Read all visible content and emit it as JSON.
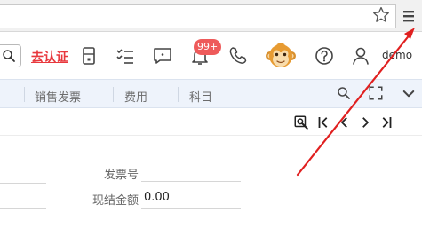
{
  "browser": {
    "bookmark_icon": "star-icon",
    "menu_icon": "hamburger-menu-icon"
  },
  "header": {
    "search_icon": "search-icon",
    "verify_link": "去认证",
    "icons": [
      "calculator-icon",
      "task-checklist-icon",
      "message-icon",
      "notification-bell-icon",
      "phone-icon",
      "help-circle-icon",
      "user-icon"
    ],
    "notification_badge": "99+",
    "avatar": "monkey-avatar",
    "username": "demo"
  },
  "tabs": {
    "items": [
      "销售发票",
      "费用",
      "科目"
    ],
    "tools": [
      "search-icon",
      "fullscreen-icon",
      "chevron-down-icon"
    ]
  },
  "pager": {
    "icons": [
      "view-search-icon",
      "first-page-icon",
      "previous-page-icon",
      "next-page-icon",
      "last-page-icon"
    ]
  },
  "form": {
    "invoice_no_label": "发票号",
    "invoice_no_value": "",
    "cash_amount_label": "现结金额",
    "cash_amount_value": "0.00"
  },
  "colors": {
    "link_red": "#e8383d",
    "badge_red": "#ee5a5a",
    "tabs_bg": "#eef3fb",
    "annotation_arrow": "#e02020"
  }
}
